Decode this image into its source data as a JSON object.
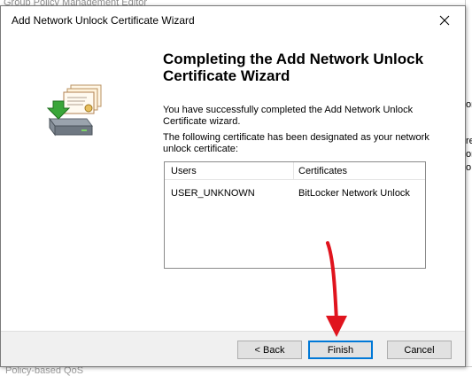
{
  "background": {
    "title": "Group Policy Management Editor",
    "right_fragments": [
      "on",
      "re",
      "or",
      "o"
    ],
    "bottom_text": "Policy-based QoS"
  },
  "dialog": {
    "title": "Add Network Unlock Certificate Wizard",
    "close_icon": "close-icon",
    "heading": "Completing the Add Network Unlock Certificate Wizard",
    "paragraph1": "You have successfully completed the Add Network Unlock Certificate wizard.",
    "paragraph2": "The following certificate has been designated as your network unlock certificate:",
    "table": {
      "columns": [
        "Users",
        "Certificates"
      ],
      "rows": [
        [
          "USER_UNKNOWN",
          "BitLocker Network Unlock"
        ]
      ]
    },
    "buttons": {
      "back": "< Back",
      "finish": "Finish",
      "cancel": "Cancel"
    }
  },
  "colors": {
    "focus_border": "#0078d7",
    "annotation_arrow": "#e0141e"
  }
}
